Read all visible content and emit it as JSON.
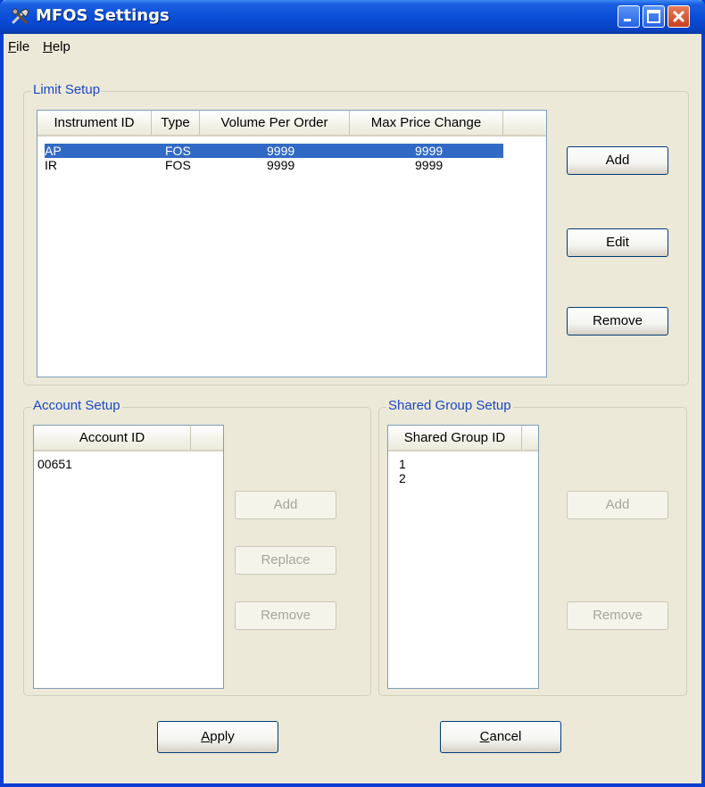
{
  "window": {
    "title": "MFOS Settings",
    "colors": {
      "title_bar": "#0a4ed8",
      "face": "#ece9d8",
      "selection": "#316ac5",
      "group_label": "#1a48c8"
    },
    "controls": [
      "minimize-icon",
      "maximize-icon",
      "close-icon"
    ]
  },
  "menu": {
    "file": {
      "prefix": "",
      "mnemonic": "F",
      "rest": "ile"
    },
    "help": {
      "prefix": "",
      "mnemonic": "H",
      "rest": "elp"
    }
  },
  "limit_setup": {
    "label": "Limit Setup",
    "columns": [
      "Instrument ID",
      "Type",
      "Volume Per Order",
      "Max Price Change"
    ],
    "rows": [
      {
        "instrument": "AP",
        "type": "FOS",
        "volume": "9999",
        "max_price": "9999",
        "selected": true
      },
      {
        "instrument": "IR",
        "type": "FOS",
        "volume": "9999",
        "max_price": "9999",
        "selected": false
      }
    ],
    "buttons": {
      "add": "Add",
      "edit": "Edit",
      "remove": "Remove"
    }
  },
  "account_setup": {
    "label": "Account Setup",
    "column": "Account ID",
    "rows": [
      "00651"
    ],
    "buttons": {
      "add": "Add",
      "replace": "Replace",
      "remove": "Remove"
    }
  },
  "shared_group_setup": {
    "label": "Shared Group Setup",
    "column": "Shared Group ID",
    "rows": [
      "1",
      "2"
    ],
    "buttons": {
      "add": "Add",
      "remove": "Remove"
    }
  },
  "footer": {
    "apply": {
      "prefix": "",
      "mnemonic": "A",
      "rest": "pply"
    },
    "cancel": {
      "prefix": "",
      "mnemonic": "C",
      "rest": "ancel"
    }
  }
}
